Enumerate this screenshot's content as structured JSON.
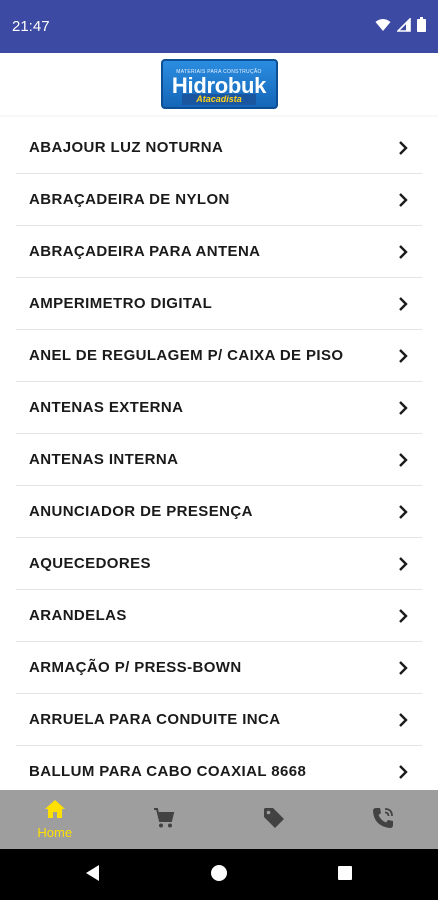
{
  "status_bar": {
    "time": "21:47",
    "icons": [
      "wifi-icon",
      "signal-icon",
      "battery-icon"
    ]
  },
  "header": {
    "logo": {
      "tagline": "MATERIAIS PARA CONSTRUÇÃO",
      "brand": "Hidrobuk",
      "sub": "Atacadista"
    }
  },
  "categories": [
    "ABAJOUR LUZ NOTURNA",
    "ABRAÇADEIRA DE NYLON",
    "ABRAÇADEIRA PARA ANTENA",
    "AMPERIMETRO DIGITAL",
    "ANEL DE REGULAGEM P/ CAIXA DE PISO",
    "ANTENAS EXTERNA",
    "ANTENAS INTERNA",
    "ANUNCIADOR DE PRESENÇA",
    "AQUECEDORES",
    "ARANDELAS",
    "ARMAÇÃO P/ PRESS-BOWN",
    "ARRUELA PARA CONDUITE INCA",
    "BALLUM PARA CABO COAXIAL 8668"
  ],
  "bottom_nav": {
    "items": [
      {
        "icon": "home-icon",
        "label": "Home",
        "active": true
      },
      {
        "icon": "cart-icon",
        "label": "",
        "active": false
      },
      {
        "icon": "tag-icon",
        "label": "",
        "active": false
      },
      {
        "icon": "phone-icon",
        "label": "",
        "active": false
      }
    ],
    "active_color": "#ffe000",
    "inactive_color": "#424242",
    "background": "#9e9e9e"
  },
  "system_nav": [
    "back-icon",
    "home-circle-icon",
    "recents-icon"
  ],
  "colors": {
    "status_bar": "#3d4aa3",
    "divider": "#e4e4e4"
  }
}
